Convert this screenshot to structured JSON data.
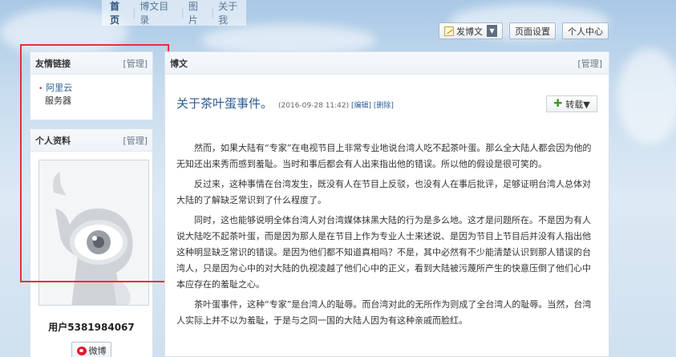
{
  "nav": {
    "items": [
      "首页",
      "博文目录",
      "图片",
      "关于我"
    ],
    "separator": "|"
  },
  "toolbar": {
    "post_label": "发博文",
    "page_settings_label": "页面设置",
    "personal_center_label": "个人中心"
  },
  "links_panel": {
    "title": "友情链接",
    "manage": "[管理]",
    "items": [
      {
        "label": "阿里云",
        "sub": "服务器"
      }
    ]
  },
  "profile_panel": {
    "title": "个人资料",
    "manage": "[管理]",
    "username": "用户5381984067",
    "weibo_label": "微博"
  },
  "blog": {
    "section_title": "博文",
    "manage": "[管理]",
    "post_title": "关于茶叶蛋事件。",
    "timestamp": "(2016-09-28 11:42)",
    "edit_label": "[编辑]",
    "delete_label": "[删除]",
    "repost_label": "转载▼",
    "paragraphs": [
      "然而，如果大陆有“专家”在电视节目上非常专业地说台湾人吃不起茶叶蛋。那么全大陆人都会因为他的无知还出来秀而感到羞耻。当时和事后都会有人出来指出他的错误。所以他的假设是很可笑的。",
      "反过来，这种事情在台湾发生，既没有人在节目上反驳，也没有人在事后批评，足够证明台湾人总体对大陆的了解缺乏常识到了什么程度了。",
      "同时，这也能够说明全体台湾人对台湾媒体抹黑大陆的行为是多么地。这才是问题所在。不是因为有人说大陆吃不起茶叶蛋，而是因为那人是在节目上作为专业人士来述说、是因为节目上节目后并没有人指出他这种明显缺乏常识的错误。是因为他们都不知道真相吗？不是，其中必然有不少能清楚认识到那人错误的台湾人，只是因为心中的对大陆的仇视凌越了他们心中的正义，看到大陆被污蔑所产生的快意压倒了他们心中本应存在的羞耻之心。",
      "茶叶蛋事件，这种“专家”是台湾人的耻辱。而台湾对此的无所作为则成了全台湾人的耻辱。当然，台湾人实际上并不以为羞耻，于是与之同一国的大陆人因为有这种亲戚而脸红。"
    ]
  },
  "colors": {
    "highlight_border": "#e53232",
    "title_link": "#2b5c92",
    "background_sky": "#c7dcee"
  }
}
